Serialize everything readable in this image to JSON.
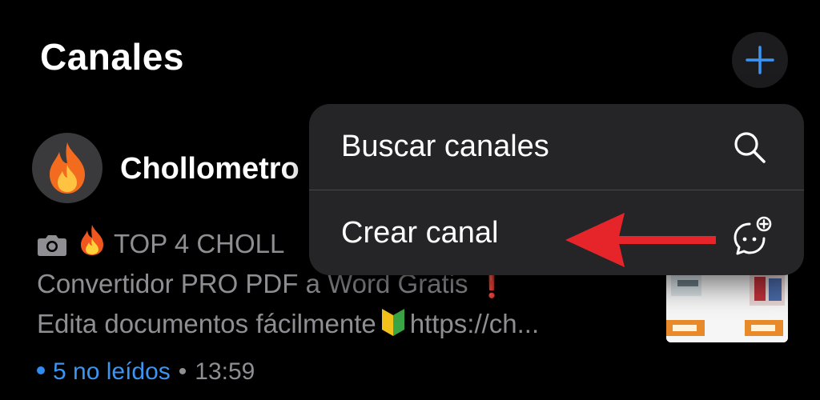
{
  "header": {
    "title": "Canales",
    "add_icon": "plus-icon"
  },
  "channel": {
    "name": "Chollometro",
    "avatar_icon": "flame-icon",
    "preview": {
      "line1_text": "TOP 4 CHOLL",
      "line2_text": "Convertidor PRO PDF a Word Gratis",
      "line3_start": "Edita documentos fácilmente",
      "line3_end": "https://ch..."
    },
    "unread": "5 no leídos",
    "separator": "•",
    "time": "13:59"
  },
  "menu": {
    "items": [
      {
        "label": "Buscar canales",
        "icon": "search-icon"
      },
      {
        "label": "Crear canal",
        "icon": "create-channel-icon"
      }
    ]
  },
  "colors": {
    "accent": "#3a95f3",
    "arrow": "#e6252a",
    "menu_bg": "#252527"
  }
}
